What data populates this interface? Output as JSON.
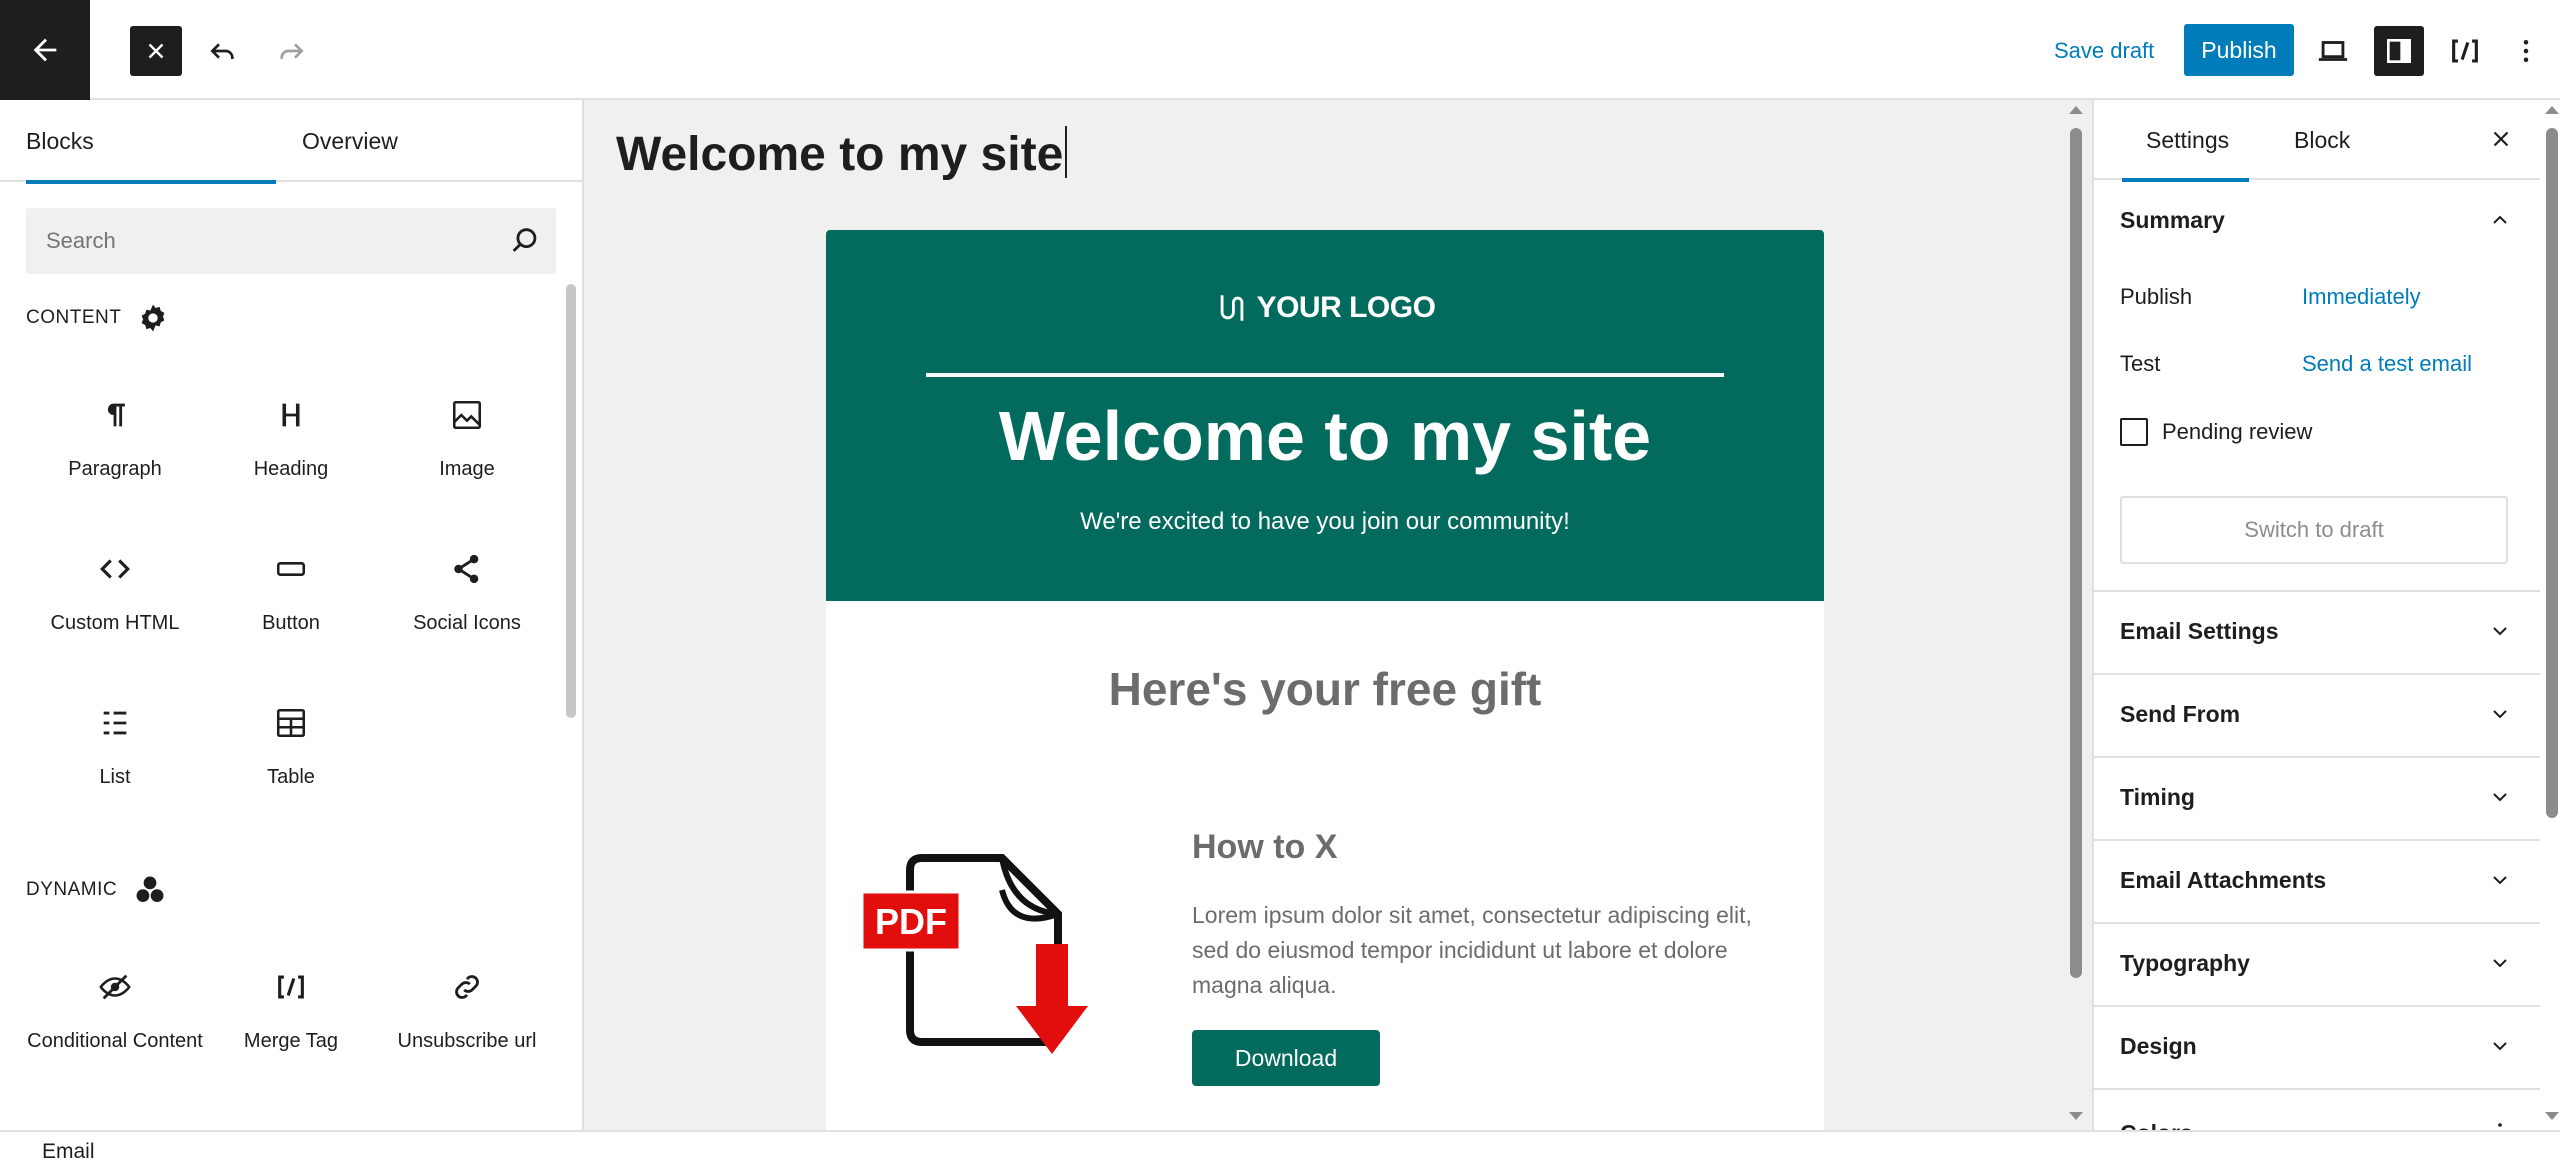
{
  "toolbar": {
    "save_draft": "Save draft",
    "publish": "Publish"
  },
  "left_sidebar": {
    "tabs": [
      "Blocks",
      "Overview"
    ],
    "active_tab": "Blocks",
    "search_placeholder": "Search",
    "categories": [
      {
        "label": "CONTENT",
        "icon": "gear-icon",
        "blocks": [
          {
            "label": "Paragraph",
            "icon": "paragraph-icon"
          },
          {
            "label": "Heading",
            "icon": "heading-icon"
          },
          {
            "label": "Image",
            "icon": "image-icon"
          },
          {
            "label": "Custom HTML",
            "icon": "code-icon"
          },
          {
            "label": "Button",
            "icon": "button-icon"
          },
          {
            "label": "Social Icons",
            "icon": "share-icon"
          },
          {
            "label": "List",
            "icon": "list-icon"
          },
          {
            "label": "Table",
            "icon": "table-icon"
          }
        ]
      },
      {
        "label": "DYNAMIC",
        "icon": "dynamic-icon",
        "blocks": [
          {
            "label": "Conditional Content",
            "icon": "eye-slash-icon"
          },
          {
            "label": "Merge Tag",
            "icon": "merge-tag-icon"
          },
          {
            "label": "Unsubscribe url",
            "icon": "link-icon"
          }
        ]
      }
    ]
  },
  "canvas": {
    "post_title": "Welcome to my site",
    "email": {
      "logo_text": "YOUR LOGO",
      "hero_title": "Welcome to my site",
      "hero_subtitle": "We're excited to have you join our community!",
      "gift_heading": "Here's your free gift",
      "pdf_label": "PDF",
      "item_title": "How to X",
      "item_body": "Lorem ipsum dolor sit amet, consectetur adipiscing elit, sed do eiusmod tempor incididunt ut labore et dolore magna aliqua.",
      "download_label": "Download",
      "brand_color": "#036b5d"
    }
  },
  "right_sidebar": {
    "tabs": [
      "Settings",
      "Block"
    ],
    "active_tab": "Settings",
    "summary": {
      "title": "Summary",
      "publish_label": "Publish",
      "publish_value": "Immediately",
      "test_label": "Test",
      "test_value": "Send a test email",
      "pending_review": "Pending review",
      "switch_to_draft": "Switch to draft"
    },
    "panels": [
      "Email Settings",
      "Send From",
      "Timing",
      "Email Attachments",
      "Typography",
      "Design",
      "Colors"
    ]
  },
  "footer": {
    "breadcrumb": "Email"
  },
  "colors": {
    "accent": "#007cba",
    "dark": "#1e1e1e"
  }
}
